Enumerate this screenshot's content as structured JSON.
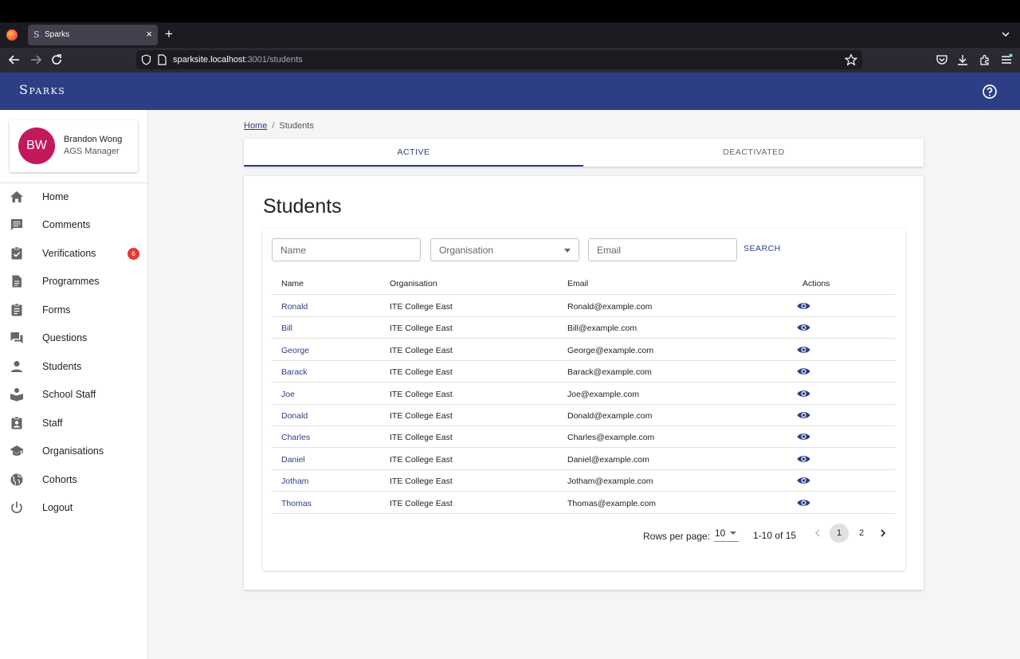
{
  "browser": {
    "tab_title": "Sparks",
    "tab_favicon": "S",
    "url_host": "sparksite.localhost",
    "url_path": ":3001/students"
  },
  "app": {
    "brand": "Sparks"
  },
  "profile": {
    "initials": "BW",
    "name": "Brandon Wong",
    "role": "AGS Manager"
  },
  "sidebar": {
    "items": [
      {
        "label": "Home",
        "icon": "home-icon"
      },
      {
        "label": "Comments",
        "icon": "comment-icon"
      },
      {
        "label": "Verifications",
        "icon": "check-clipboard-icon",
        "badge": "6"
      },
      {
        "label": "Programmes",
        "icon": "document-icon"
      },
      {
        "label": "Forms",
        "icon": "clipboard-list-icon"
      },
      {
        "label": "Questions",
        "icon": "forum-icon"
      },
      {
        "label": "Students",
        "icon": "person-icon"
      },
      {
        "label": "School Staff",
        "icon": "book-reader-icon"
      },
      {
        "label": "Staff",
        "icon": "badge-icon"
      },
      {
        "label": "Organisations",
        "icon": "school-icon"
      },
      {
        "label": "Cohorts",
        "icon": "globe-icon"
      },
      {
        "label": "Logout",
        "icon": "power-icon"
      }
    ]
  },
  "breadcrumb": {
    "home": "Home",
    "separator": "/",
    "current": "Students"
  },
  "tabs": {
    "active": "ACTIVE",
    "deactivated": "DEACTIVATED"
  },
  "page": {
    "title": "Students"
  },
  "filters": {
    "name_placeholder": "Name",
    "organisation_placeholder": "Organisation",
    "email_placeholder": "Email",
    "search_label": "SEARCH"
  },
  "table": {
    "headers": [
      "Name",
      "Organisation",
      "Email",
      "Actions"
    ],
    "rows": [
      {
        "name": "Ronald",
        "organisation": "ITE College East",
        "email": "Ronald@example.com"
      },
      {
        "name": "Bill",
        "organisation": "ITE College East",
        "email": "Bill@example.com"
      },
      {
        "name": "George",
        "organisation": "ITE College East",
        "email": "George@example.com"
      },
      {
        "name": "Barack",
        "organisation": "ITE College East",
        "email": "Barack@example.com"
      },
      {
        "name": "Joe",
        "organisation": "ITE College East",
        "email": "Joe@example.com"
      },
      {
        "name": "Donald",
        "organisation": "ITE College East",
        "email": "Donald@example.com"
      },
      {
        "name": "Charles",
        "organisation": "ITE College East",
        "email": "Charles@example.com"
      },
      {
        "name": "Daniel",
        "organisation": "ITE College East",
        "email": "Daniel@example.com"
      },
      {
        "name": "Jotham",
        "organisation": "ITE College East",
        "email": "Jotham@example.com"
      },
      {
        "name": "Thomas",
        "organisation": "ITE College East",
        "email": "Thomas@example.com"
      }
    ]
  },
  "pagination": {
    "rows_per_page_label": "Rows per page:",
    "rows_per_page": "10",
    "range": "1-10 of 15",
    "pages": [
      "1",
      "2"
    ],
    "current_page": "1"
  },
  "colors": {
    "header": "#2d3d86",
    "avatar": "#c4185d",
    "badge": "#e53935",
    "link": "#2d3d86"
  }
}
